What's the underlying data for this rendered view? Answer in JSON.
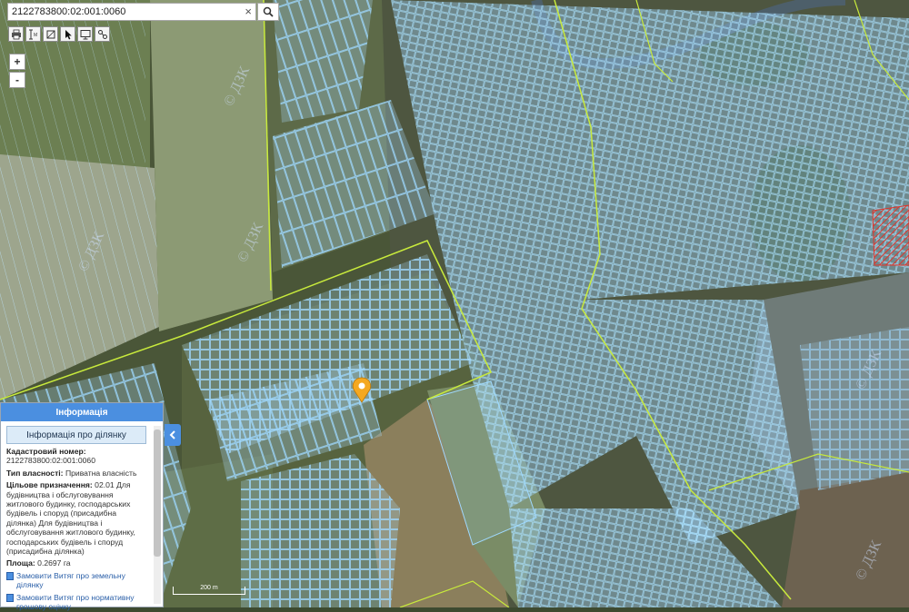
{
  "search": {
    "value": "2122783800:02:001:0060",
    "clear_glyph": "×"
  },
  "toolbar": {
    "items": [
      "print-icon",
      "measure-length-icon",
      "measure-area-icon",
      "pointer-icon",
      "monitor-icon",
      "layers-icon"
    ]
  },
  "zoom": {
    "in_label": "+",
    "out_label": "-"
  },
  "info_panel": {
    "title": "Інформація",
    "subtitle": "Інформація про ділянку",
    "cadastral_label": "Кадастровий номер:",
    "cadastral_value": "2122783800:02:001:0060",
    "ownership_label": "Тип власності:",
    "ownership_value": "Приватна власність",
    "purpose_label": "Цільове призначення:",
    "purpose_value": "02.01 Для будівництва і обслуговування житлового будинку, господарських будівель і споруд (присадибна ділянка) Для будівництва і обслуговування житлового будинку, господарських будівель і споруд (присадибна ділянка)",
    "area_label": "Площа:",
    "area_value": "0.2697 га",
    "link_extract": "Замовити Витяг про земельну ділянку",
    "link_valuation": "Замовити Витяг про нормативну грошову оцінку"
  },
  "map": {
    "scale_label": "200 m",
    "watermark": "© ДЗК"
  },
  "colors": {
    "accent": "#4b8fe0",
    "parcel_stroke": "#9fd9ff",
    "boundary": "#c8ea3c",
    "marker": "#f4a821",
    "selected_hatch": "#e0352b"
  }
}
